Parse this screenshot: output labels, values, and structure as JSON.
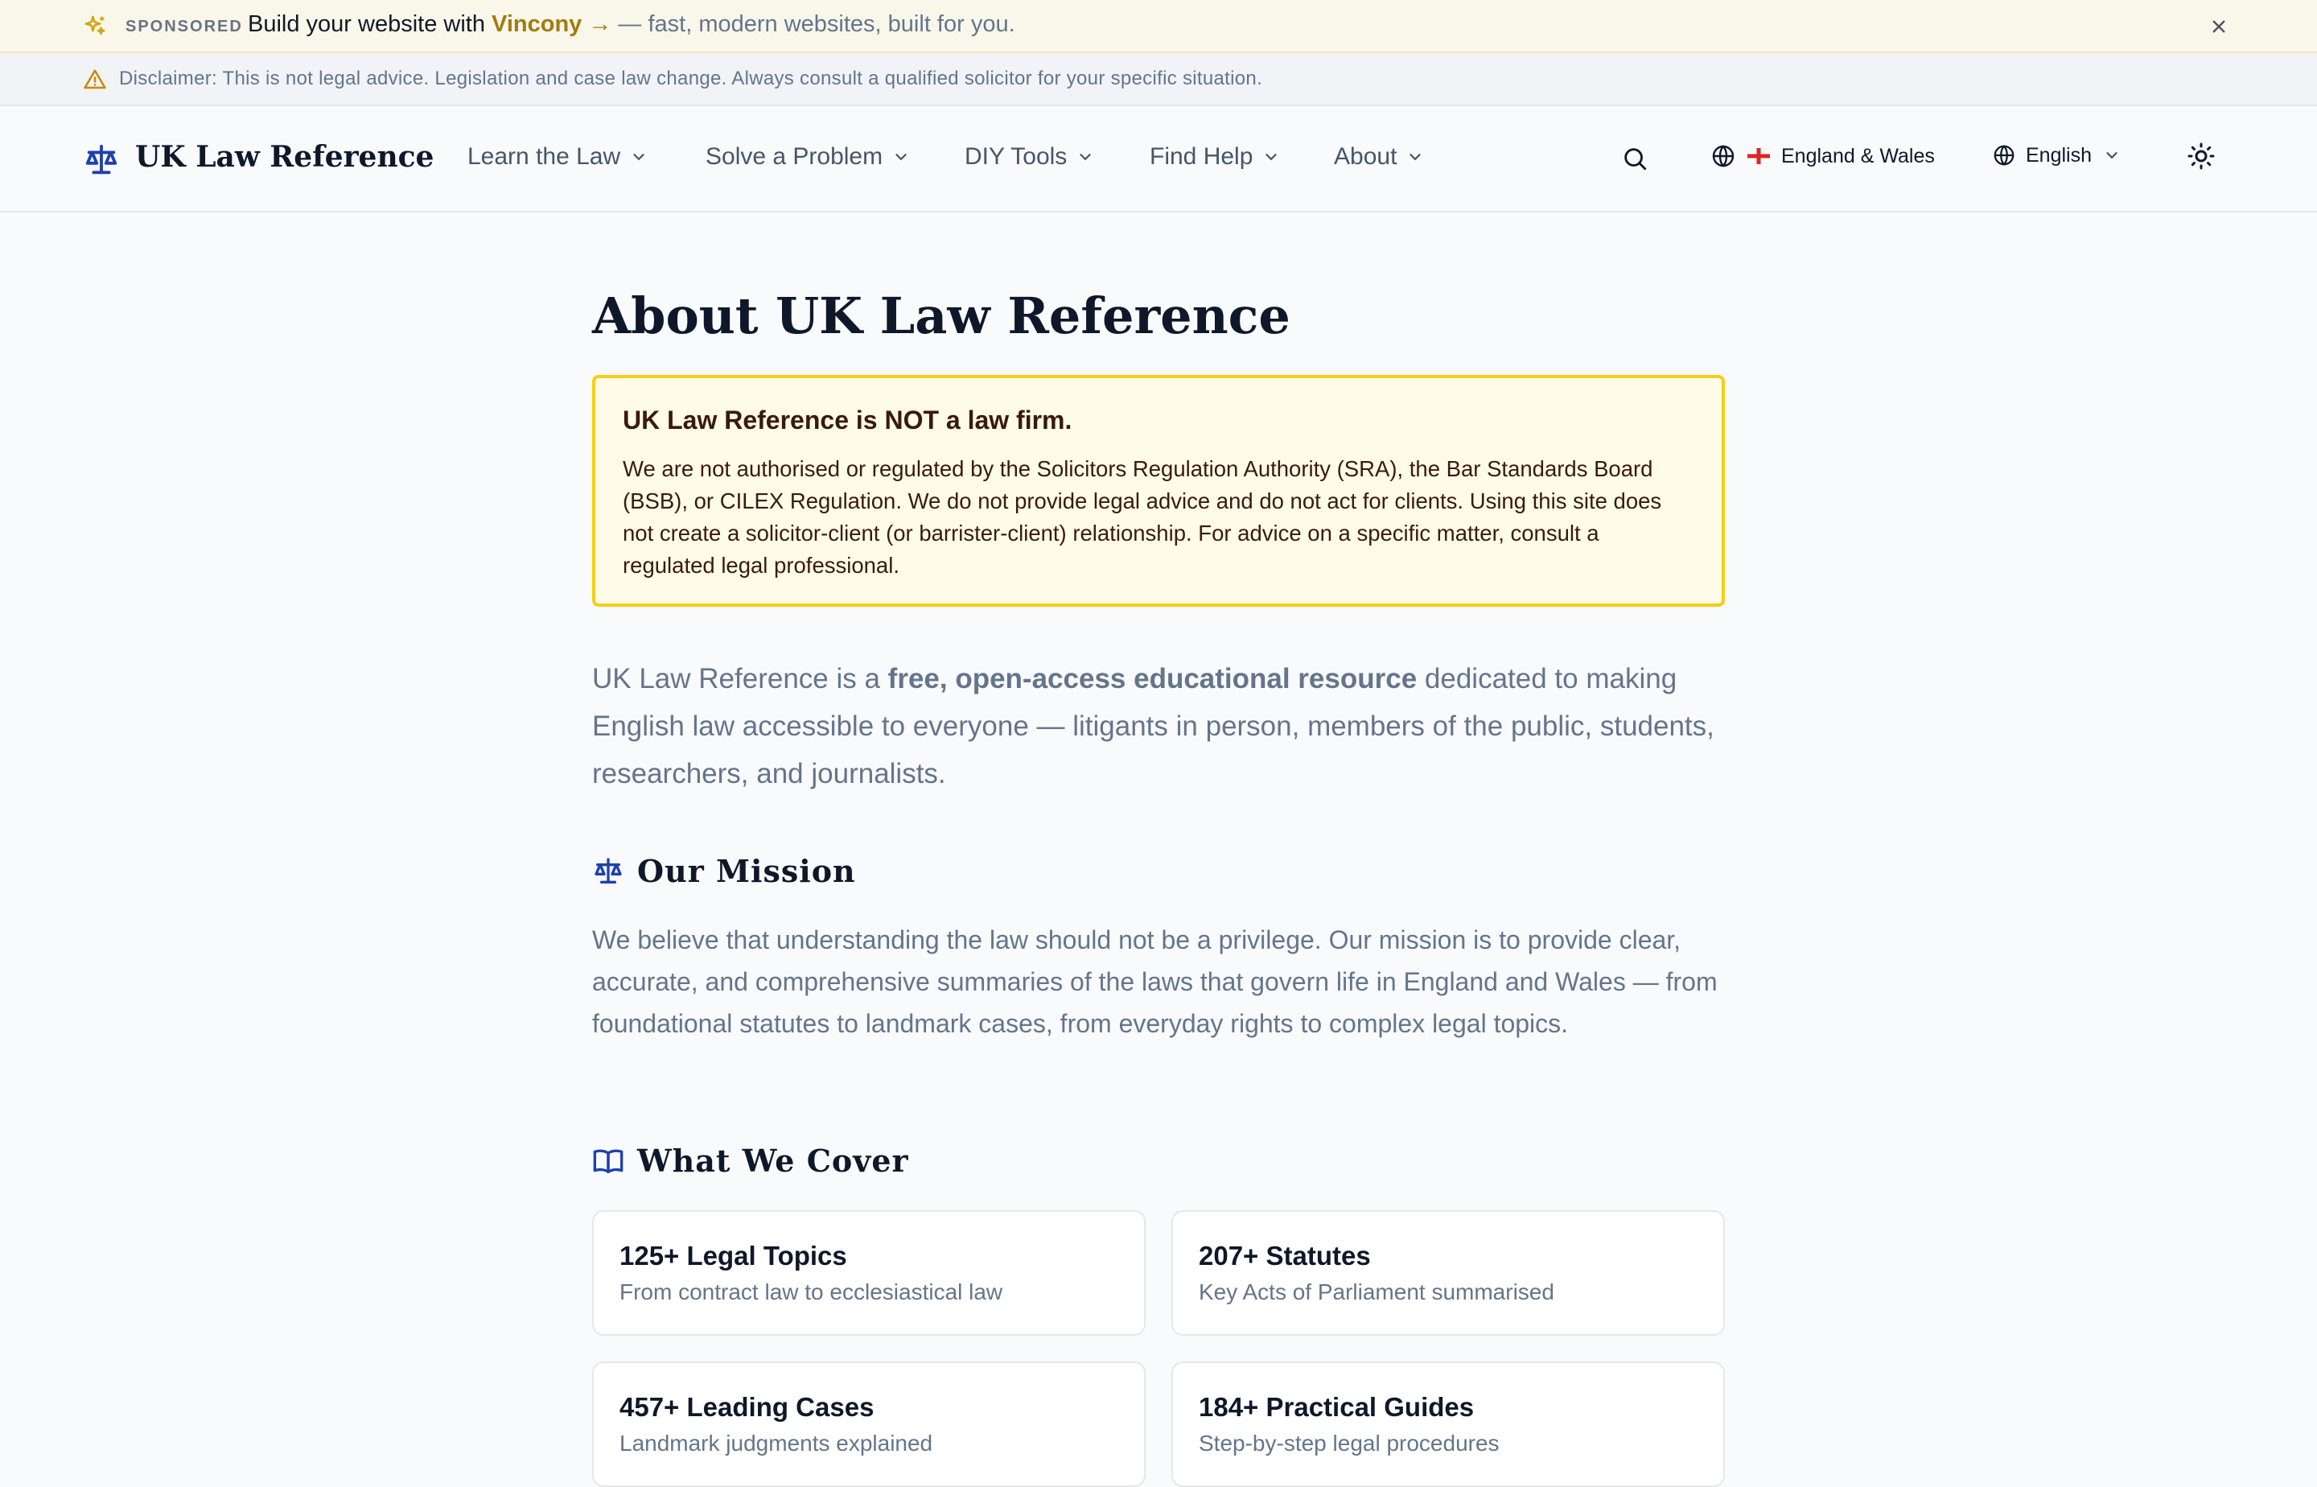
{
  "promo": {
    "tag": "SPONSORED",
    "text_before": "Build your website with ",
    "brand": "Vincony",
    "arrow": " →",
    "text_after": " — fast, modern websites, built for you."
  },
  "disclaimer": {
    "text": "Disclaimer: This is not legal advice. Legislation and case law change. Always consult a qualified solicitor for your specific situation."
  },
  "nav": {
    "logo": "UK Law Reference",
    "menu": [
      "Learn the Law",
      "Solve a Problem",
      "DIY Tools",
      "Find Help",
      "About"
    ],
    "region": "England & Wales",
    "language": "English"
  },
  "page": {
    "title": "About UK Law Reference",
    "notice": {
      "title": "UK Law Reference is NOT a law firm.",
      "body": "We are not authorised or regulated by the Solicitors Regulation Authority (SRA), the Bar Standards Board (BSB), or CILEX Regulation. We do not provide legal advice and do not act for clients. Using this site does not create a solicitor-client (or barrister-client) relationship. For advice on a specific matter, consult a regulated legal professional."
    },
    "lead": {
      "before": "UK Law Reference is a ",
      "bold": "free, open-access educational resource",
      "after": " dedicated to making English law accessible to everyone — litigants in person, members of the public, students, researchers, and journalists."
    },
    "mission": {
      "heading": "Our Mission",
      "text": "We believe that understanding the law should not be a privilege. Our mission is to provide clear, accurate, and comprehensive summaries of the laws that govern life in England and Wales — from foundational statutes to landmark cases, from everyday rights to complex legal topics."
    },
    "cover": {
      "heading": "What We Cover",
      "cards": [
        {
          "title": "125+ Legal Topics",
          "sub": "From contract law to ecclesiastical law"
        },
        {
          "title": "207+ Statutes",
          "sub": "Key Acts of Parliament summarised"
        },
        {
          "title": "457+ Leading Cases",
          "sub": "Landmark judgments explained"
        },
        {
          "title": "184+ Practical Guides",
          "sub": "Step-by-step legal procedures"
        }
      ]
    }
  },
  "colors": {
    "accent_blue": "#1e40af",
    "brand_gold": "#a27b10",
    "notice_border": "#facc15",
    "notice_bg": "#fefce8"
  }
}
